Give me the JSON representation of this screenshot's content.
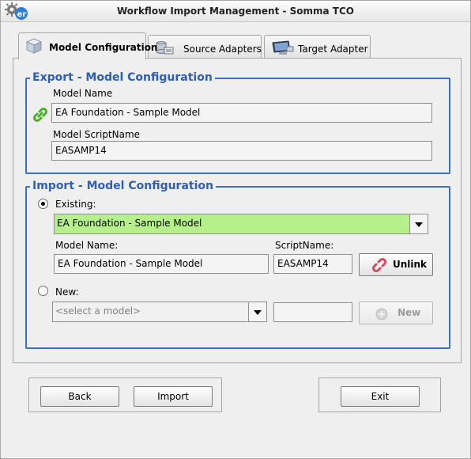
{
  "window": {
    "title": "Workflow Import Management - Somma TCO"
  },
  "tabs": [
    {
      "label": "Model Configuration",
      "icon": "cube-icon",
      "active": true
    },
    {
      "label": "Source Adapters",
      "icon": "database-icon",
      "active": false
    },
    {
      "label": "Target Adapter",
      "icon": "monitor-icon",
      "active": false
    }
  ],
  "export": {
    "title": "Export - Model Configuration",
    "model_name_label": "Model Name",
    "model_name_value": "EA Foundation - Sample Model",
    "script_name_label": "Model ScriptName",
    "script_name_value": "EASAMP14",
    "link_icon": "link-icon"
  },
  "import": {
    "title": "Import - Model Configuration",
    "existing_label": "Existing:",
    "existing_selected": "EA Foundation - Sample Model",
    "model_name_label": "Model Name:",
    "model_name_value": "EA Foundation - Sample Model",
    "script_name_label": "ScriptName:",
    "script_name_value": "EASAMP14",
    "unlink_label": "Unlink",
    "new_label": "New:",
    "new_select_placeholder": "<select a model>",
    "new_script_value": "",
    "new_button_label": "New"
  },
  "footer": {
    "back_label": "Back",
    "import_label": "Import",
    "exit_label": "Exit"
  },
  "colors": {
    "group_border": "#3b6fc0",
    "group_title": "#2f5fb3",
    "existing_combo_bg": "#b6f08c",
    "link_icon": "#4caf2a",
    "unlink_icon": "#d9485a"
  }
}
